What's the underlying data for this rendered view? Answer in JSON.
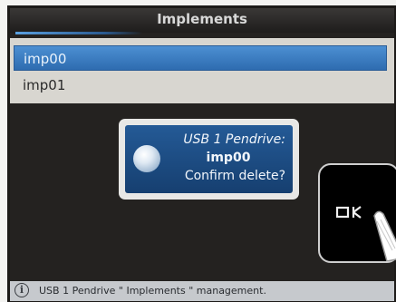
{
  "window": {
    "title": "Implements"
  },
  "list": {
    "items": [
      {
        "label": "imp00",
        "selected": true
      },
      {
        "label": "imp01",
        "selected": false
      }
    ]
  },
  "dialog": {
    "device": "USB 1 Pendrive:",
    "name": "imp00",
    "question": "Confirm delete?",
    "icon": "globe-icon"
  },
  "ok_button": {
    "label": "OK",
    "icon": "finger-press-icon"
  },
  "status": {
    "icon": "info-icon",
    "text": "USB 1 Pendrive \" Implements \" management."
  },
  "colors": {
    "accent": "#3a7fc4",
    "dialog_bg": "#1d4c85",
    "statusbar": "#c6c9cd"
  }
}
